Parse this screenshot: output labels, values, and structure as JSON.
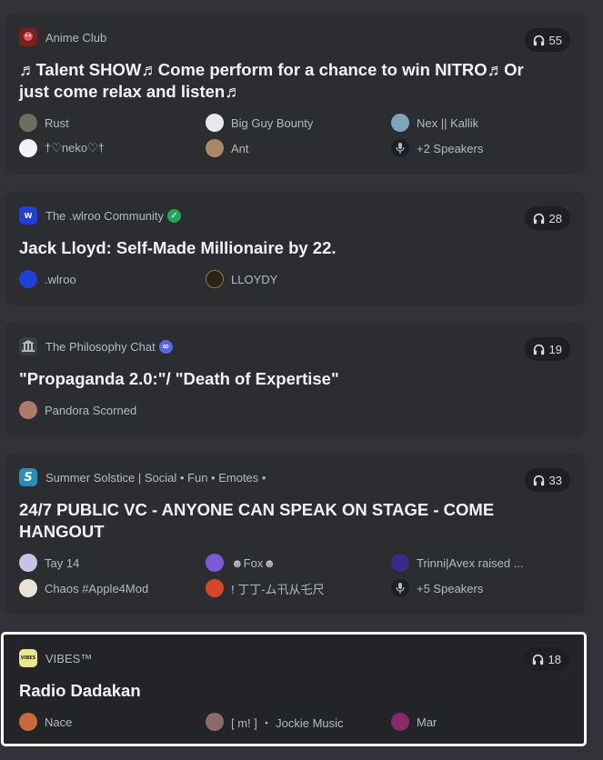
{
  "stages": [
    {
      "guild": "Anime Club",
      "guild_icon": {
        "name": "anime-club-icon",
        "color": "#c0392b"
      },
      "listeners": "55",
      "title": "♬Talent SHOW♬Come perform for a chance to win NITRO♬Or just come relax and listen♬",
      "speakers": [
        {
          "name": "Rust",
          "color": "#6b6f5e"
        },
        {
          "name": "Big Guy Bounty",
          "color": "#e8e8e8"
        },
        {
          "name": "Nex || Kallik",
          "color": "#7fa6b8"
        },
        {
          "name": "†♡neko♡†",
          "color": "#f2f2f2"
        },
        {
          "name": "Ant",
          "color": "#a88a6a"
        },
        {
          "name": "+2 Speakers",
          "color": "#1e1f22",
          "is_more": true
        }
      ]
    },
    {
      "guild": "The .wlroo Community",
      "guild_icon": {
        "name": "wlroo-icon",
        "color": "#1f3fd6"
      },
      "verified": true,
      "listeners": "28",
      "title": "Jack Lloyd: Self-Made Millionaire by 22.",
      "speakers": [
        {
          "name": ".wlroo",
          "color": "#1f3fd6"
        },
        {
          "name": "LLOYDY",
          "color": "#2a2418"
        }
      ]
    },
    {
      "guild": "The Philosophy Chat",
      "guild_icon": {
        "name": "philosophy-chat-icon",
        "color": "#3a3d44"
      },
      "partner": true,
      "listeners": "19",
      "title": "\"Propaganda 2.0:\"/ \"Death of Expertise\"",
      "speakers": [
        {
          "name": "Pandora Scorned",
          "color": "#b07a6a"
        }
      ]
    },
    {
      "guild": "Summer Solstice | Social • Fun • Emotes •",
      "guild_icon": {
        "name": "summer-solstice-icon",
        "color": "#2a8fb8"
      },
      "listeners": "33",
      "title": "24/7 PUBLIC VC - ANYONE CAN SPEAK ON STAGE - COME HANGOUT",
      "speakers": [
        {
          "name": "Tay 14",
          "color": "#c7c2e8"
        },
        {
          "name": "☻Fox☻",
          "color": "#7a5ad8"
        },
        {
          "name": "Trinni|Avex raised ...",
          "color": "#3a2a8a"
        },
        {
          "name": "Chaos #Apple4Mod",
          "color": "#e8e4d8"
        },
        {
          "name": "! 丁丁-ム卂从乇尺",
          "color": "#d8462a"
        },
        {
          "name": "+5 Speakers",
          "color": "#1e1f22",
          "is_more": true
        }
      ]
    },
    {
      "guild": "VIBES™",
      "guild_icon": {
        "name": "vibes-icon",
        "color": "#e8e88a",
        "text": "VIBES"
      },
      "listeners": "18",
      "title": "Radio Dadakan",
      "selected": true,
      "speakers": [
        {
          "name": "Nace",
          "color": "#c86a3a"
        },
        {
          "name": "[ m! ] ・ Jockie Music",
          "color": "#8a6a6a"
        },
        {
          "name": "Mar",
          "color": "#8a2a6a"
        }
      ]
    }
  ]
}
